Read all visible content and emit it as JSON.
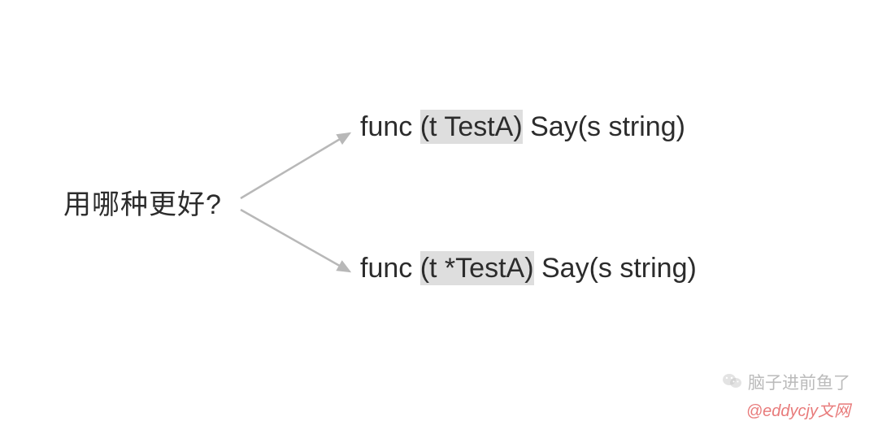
{
  "question": "用哪种更好?",
  "option1": {
    "prefix": "func ",
    "receiver": "(t TestA)",
    "suffix": " Say(s string)"
  },
  "option2": {
    "prefix": "func ",
    "receiver": "(t *TestA)",
    "suffix": " Say(s string)"
  },
  "watermark1": "脑子进前鱼了",
  "watermark2": "@eddycjy文网"
}
